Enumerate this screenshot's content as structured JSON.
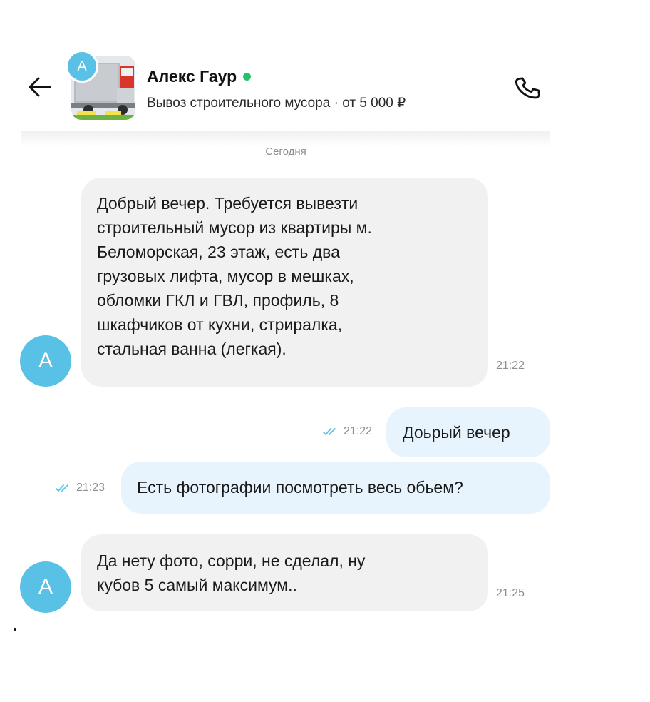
{
  "header": {
    "contact_name": "Алекс Гаур",
    "contact_initial": "A",
    "ad_title": "Вывоз строительного мусора · от 5 000 ₽",
    "online": true,
    "accent_color": "#5ac1e6",
    "online_color": "#25c26e",
    "icons": {
      "back": "arrow-left-icon",
      "call": "phone-icon"
    }
  },
  "date_separator": "Сегодня",
  "messages": [
    {
      "direction": "incoming",
      "sender_initial": "A",
      "text": "Добрый вечер. Требуется вывезти\nстроительный мусор из квартиры м.\nБеломорская, 23 этаж, есть два\nгрузовых лифта, мусор в мешках,\nобломки ГКЛ и ГВЛ, профиль, 8\nшкафчиков от кухни, стриралка,\nстальная ванна (легкая).",
      "time": "21:22"
    },
    {
      "direction": "outgoing",
      "text": "Доьрый вечер",
      "time": "21:22",
      "status": "read"
    },
    {
      "direction": "outgoing",
      "text": "Есть фотографии посмотреть весь обьем?",
      "time": "21:23",
      "status": "read"
    },
    {
      "direction": "incoming",
      "sender_initial": "A",
      "text": "Да нету фото, сорри, не сделал, ну\nкубов 5 самый максимум..",
      "time": "21:25"
    }
  ]
}
